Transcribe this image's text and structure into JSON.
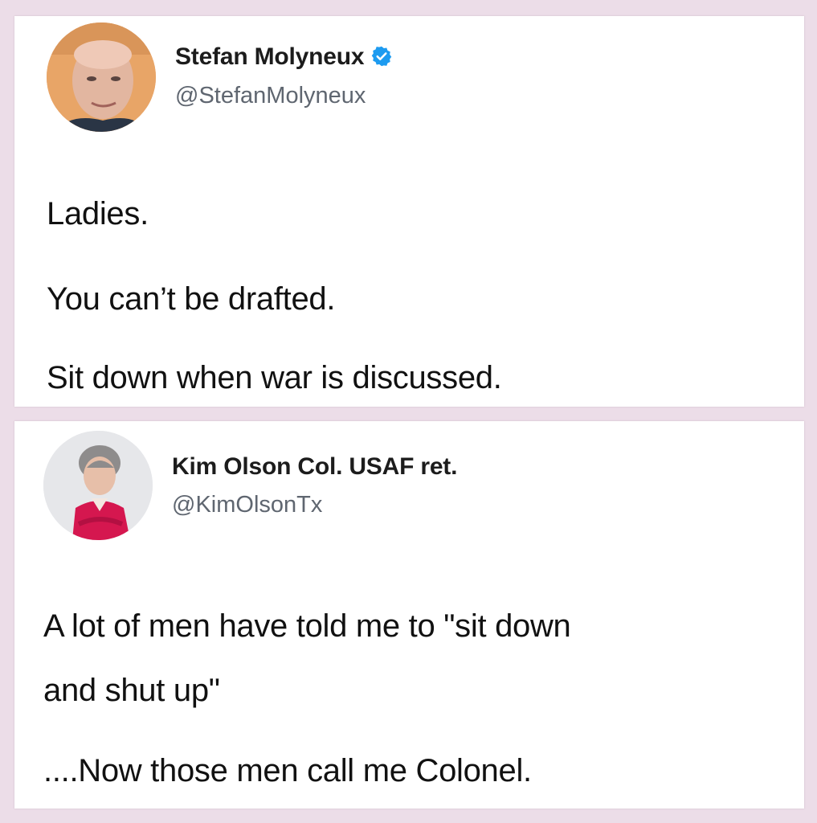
{
  "tweet1": {
    "author_name": "Stefan Molyneux",
    "verified_icon": "verified-badge-icon",
    "handle": "@StefanMolyneux",
    "lines": [
      "Ladies.",
      "You can’t be drafted.",
      "Sit down when war is discussed."
    ]
  },
  "tweet2": {
    "author_name": "Kim Olson Col. USAF ret.",
    "handle": "@KimOlsonTx",
    "lines": [
      "A lot of men have told me to \"sit down",
      "and shut up\"",
      "....Now those men call me Colonel."
    ]
  },
  "colors": {
    "background": "#ecdde8",
    "card": "#ffffff",
    "verified_blue": "#1d9bf0"
  }
}
